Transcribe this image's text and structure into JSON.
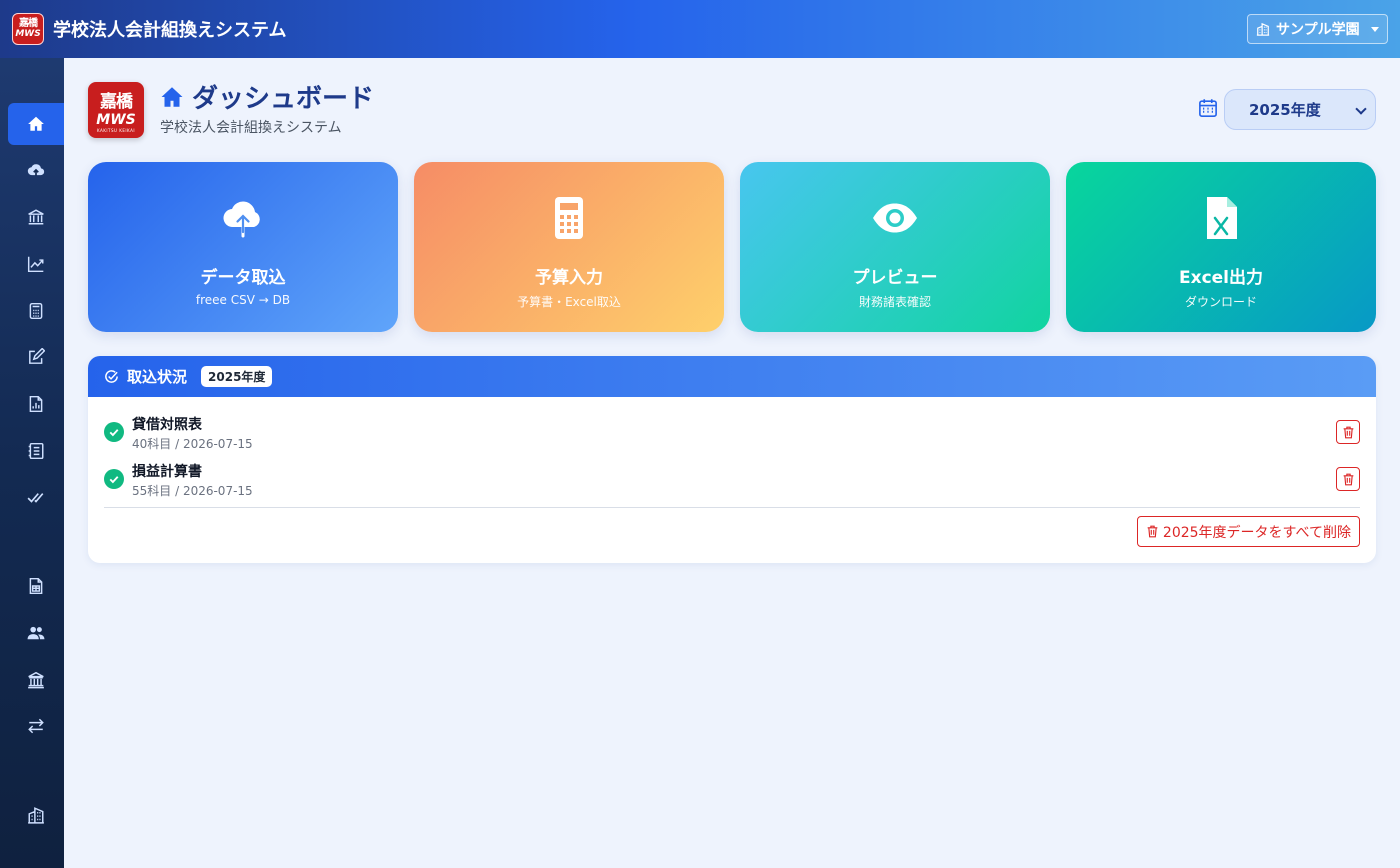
{
  "app": {
    "title": "学校法人会計組換えシステム",
    "logo_top": "嘉橋",
    "logo_bottom": "MWS",
    "school_selector": "サンプル学園"
  },
  "sidebar": {
    "items": [
      {
        "icon": "home-icon",
        "active": true
      },
      {
        "icon": "cloud-upload-icon",
        "active": false
      },
      {
        "icon": "bank-icon",
        "active": false
      },
      {
        "icon": "chart-line-icon",
        "active": false
      },
      {
        "icon": "calculator-icon",
        "active": false
      },
      {
        "icon": "edit-icon",
        "active": false
      },
      {
        "icon": "report-icon",
        "active": false
      },
      {
        "icon": "journal-icon",
        "active": false
      },
      {
        "icon": "double-check-icon",
        "active": false
      },
      {
        "icon": "spreadsheet-file-icon",
        "active": false
      },
      {
        "icon": "people-icon",
        "active": false
      },
      {
        "icon": "institution-icon",
        "active": false
      },
      {
        "icon": "arrows-exchange-icon",
        "active": false
      },
      {
        "icon": "building-icon",
        "active": false
      }
    ]
  },
  "header": {
    "logo_top": "嘉橋",
    "logo_bottom": "MWS",
    "logo_caption": "KAKITSU KEIKAI",
    "title": "ダッシュボード",
    "subtitle": "学校法人会計組換えシステム",
    "year": "2025年度"
  },
  "cards": [
    {
      "title": "データ取込",
      "subtitle": "freee CSV → DB",
      "icon": "cloud-upload-icon"
    },
    {
      "title": "予算入力",
      "subtitle": "予算書・Excel取込",
      "icon": "calculator-icon"
    },
    {
      "title": "プレビュー",
      "subtitle": "財務諸表確認",
      "icon": "eye-icon"
    },
    {
      "title": "Excel出力",
      "subtitle": "ダウンロード",
      "icon": "excel-file-icon"
    }
  ],
  "import_status": {
    "title": "取込状況",
    "year_badge": "2025年度",
    "rows": [
      {
        "name": "貸借対照表",
        "meta": "40科目 / 2026-07-15"
      },
      {
        "name": "損益計算書",
        "meta": "55科目 / 2026-07-15"
      }
    ],
    "delete_all_label": "2025年度データをすべて削除"
  },
  "colors": {
    "primary": "#2563eb",
    "danger": "#dc2626",
    "success": "#10b981",
    "brand_red": "#c81e1e"
  }
}
